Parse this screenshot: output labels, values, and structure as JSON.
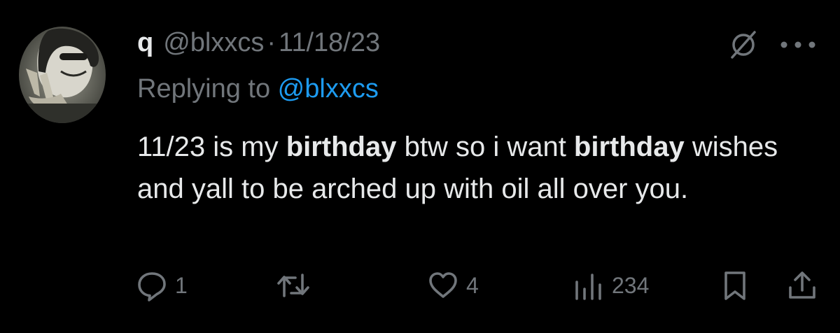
{
  "tweet": {
    "display_name": "q",
    "handle": "@blxxcs",
    "separator": "·",
    "date": "11/18/23",
    "replying_prefix": "Replying to ",
    "replying_handle": "@blxxcs",
    "text_parts": {
      "p1": "11/23 is my ",
      "b1": "birthday",
      "p2": " btw so i want ",
      "b2": "birthday",
      "p3": " wishes and yall to be arched up with oil all over you."
    }
  },
  "actions": {
    "reply_count": "1",
    "retweet_count": "",
    "like_count": "4",
    "views_count": "234"
  },
  "icons": {
    "grok": "grok-icon",
    "more": "more-icon",
    "reply": "reply-icon",
    "retweet": "retweet-icon",
    "like": "heart-icon",
    "views": "views-icon",
    "bookmark": "bookmark-icon",
    "share": "share-icon"
  },
  "colors": {
    "background": "#000000",
    "text": "#e7e9ea",
    "muted": "#71767b",
    "link": "#1d9bf0"
  }
}
